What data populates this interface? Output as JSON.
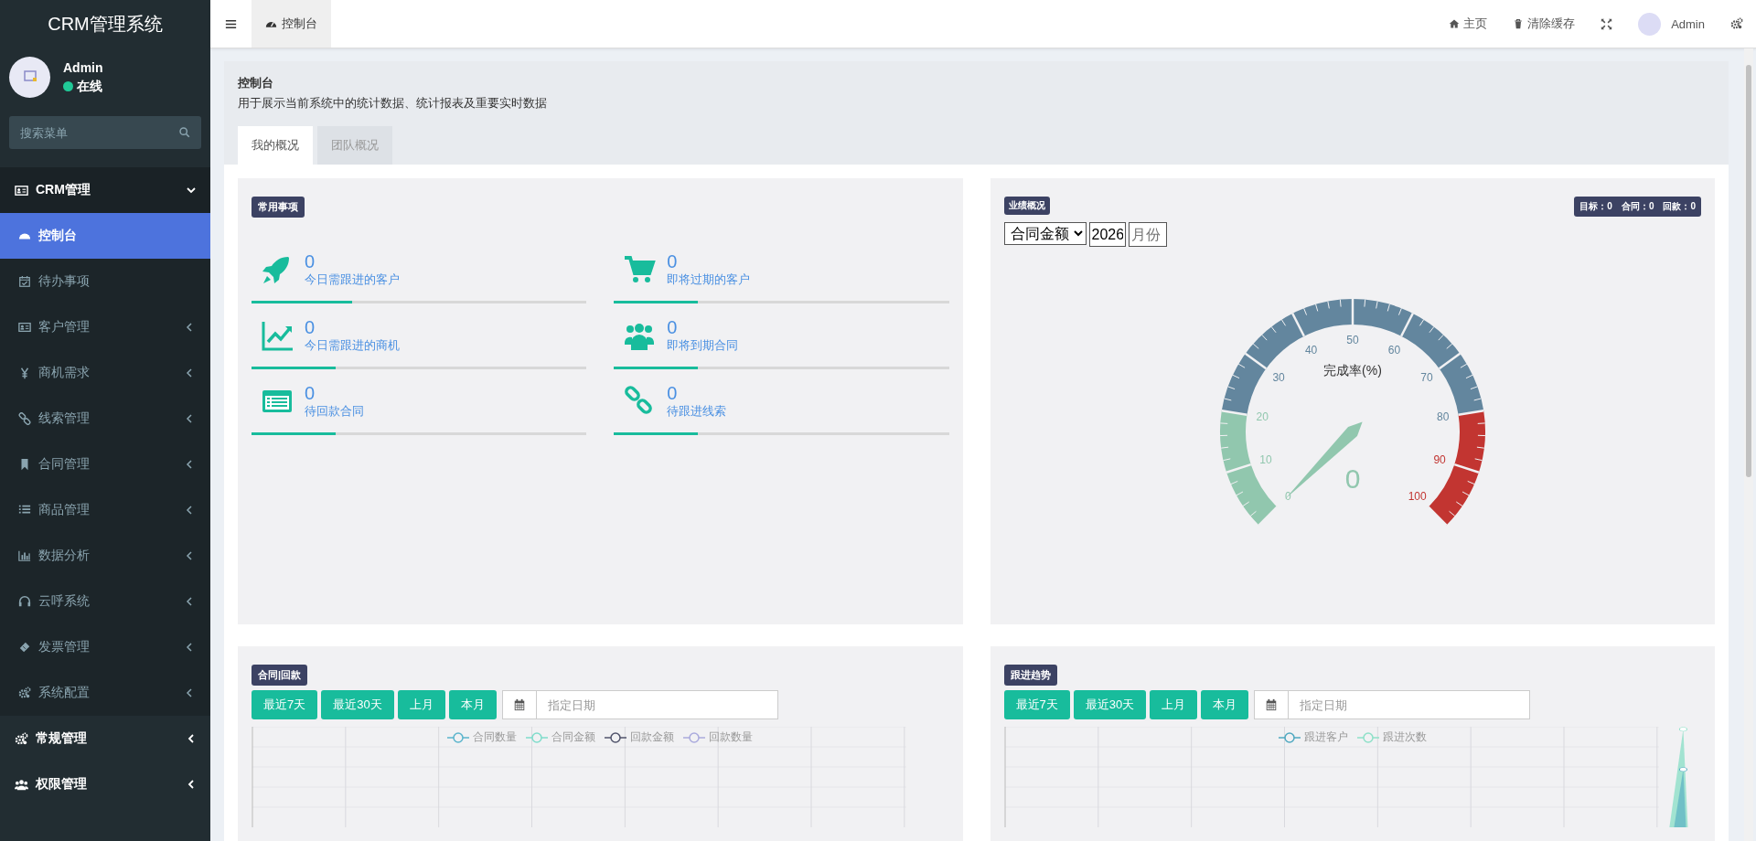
{
  "app": {
    "title": "CRM管理系统"
  },
  "user": {
    "name": "Admin",
    "status": "在线",
    "online": true
  },
  "search": {
    "placeholder": "搜索菜单"
  },
  "menu": [
    {
      "label": "CRM管理",
      "expanded": true,
      "children": [
        {
          "label": "控制台",
          "selected": true,
          "expandable": false
        },
        {
          "label": "待办事项",
          "selected": false,
          "expandable": false
        },
        {
          "label": "客户管理",
          "selected": false,
          "expandable": true
        },
        {
          "label": "商机需求",
          "selected": false,
          "expandable": true
        },
        {
          "label": "线索管理",
          "selected": false,
          "expandable": true
        },
        {
          "label": "合同管理",
          "selected": false,
          "expandable": true
        },
        {
          "label": "商品管理",
          "selected": false,
          "expandable": true
        },
        {
          "label": "数据分析",
          "selected": false,
          "expandable": true
        },
        {
          "label": "云呼系统",
          "selected": false,
          "expandable": true
        },
        {
          "label": "发票管理",
          "selected": false,
          "expandable": true
        },
        {
          "label": "系统配置",
          "selected": false,
          "expandable": true
        }
      ]
    },
    {
      "label": "常规管理",
      "expanded": false
    },
    {
      "label": "权限管理",
      "expanded": false
    }
  ],
  "header": {
    "tabs": [
      {
        "label": "控制台",
        "selected": true
      }
    ],
    "actions": [
      {
        "label": "主页"
      },
      {
        "label": "清除缓存"
      }
    ],
    "user": "Admin"
  },
  "page": {
    "title": "控制台",
    "description": "用于展示当前系统中的统计数据、统计报表及重要实时数据",
    "tabs": [
      {
        "label": "我的概况",
        "selected": true
      },
      {
        "label": "团队概况",
        "selected": false
      }
    ]
  },
  "common": {
    "title": "常用事项",
    "items": [
      {
        "value": "0",
        "label": "今日需跟进的客户",
        "level": 0.3
      },
      {
        "value": "0",
        "label": "即将过期的客户",
        "level": 0.25
      },
      {
        "value": "0",
        "label": "今日需跟进的商机",
        "level": 0.25
      },
      {
        "value": "0",
        "label": "即将到期合同",
        "level": 0.25
      },
      {
        "value": "0",
        "label": "待回款合同",
        "level": 0.25
      },
      {
        "value": "0",
        "label": "待跟进线索",
        "level": 0.25
      }
    ]
  },
  "performance": {
    "title": "业绩概况",
    "summary": [
      "目标：0",
      "合同：0",
      "回款：0"
    ],
    "type": "合同金额",
    "year": "2026",
    "month_placeholder": "月份",
    "gauge": {
      "title": "完成率(%)",
      "value": "0",
      "ticks": [
        "0",
        "10",
        "20",
        "30",
        "40",
        "50",
        "60",
        "70",
        "80",
        "90",
        "100"
      ]
    }
  },
  "charts": [
    {
      "title": "合同|回款",
      "buttons": [
        "最近7天",
        "最近30天",
        "上月",
        "本月"
      ],
      "date_placeholder": "指定日期",
      "legend": [
        {
          "label": "合同数量",
          "color": "#5ab4cc"
        },
        {
          "label": "合同金额",
          "color": "#7fdccb"
        },
        {
          "label": "回款金额",
          "color": "#50536b"
        },
        {
          "label": "回款数量",
          "color": "#aaaadd"
        }
      ]
    },
    {
      "title": "跟进趋势",
      "buttons": [
        "最近7天",
        "最近30天",
        "上月",
        "本月"
      ],
      "date_placeholder": "指定日期",
      "legend": [
        {
          "label": "跟进客户",
          "color": "#4fa8c0"
        },
        {
          "label": "跟进次数",
          "color": "#8ee0c8"
        }
      ]
    }
  ]
}
